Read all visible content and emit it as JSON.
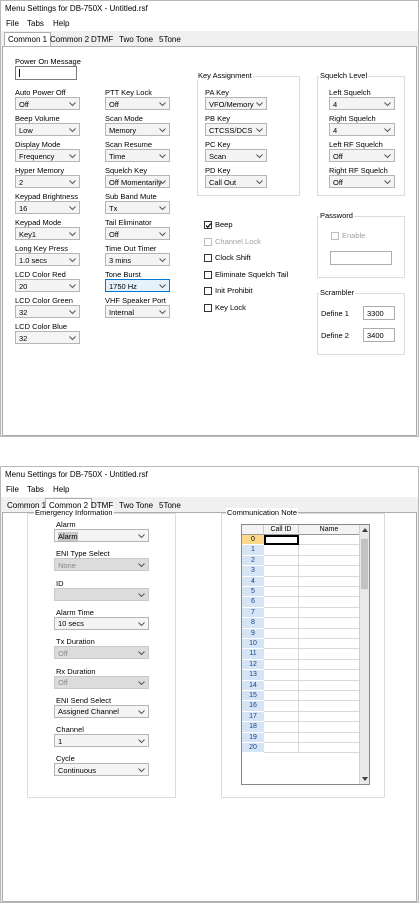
{
  "window_title": "Menu Settings for DB-750X - Untitled.rsf",
  "menu": [
    "File",
    "Tabs",
    "Help"
  ],
  "tabs": [
    "Common 1",
    "Common 2",
    "DTMF",
    "Two Tone",
    "5Tone"
  ],
  "common1": {
    "power_on_message": {
      "label": "Power On Message",
      "value": ""
    },
    "col1": [
      {
        "label": "Auto Power Off",
        "value": "Off"
      },
      {
        "label": "Beep Volume",
        "value": "Low"
      },
      {
        "label": "Display Mode",
        "value": "Frequency"
      },
      {
        "label": "Hyper Memory",
        "value": "2"
      },
      {
        "label": "Keypad Brightness",
        "value": "16"
      },
      {
        "label": "Keypad Mode",
        "value": "Key1"
      },
      {
        "label": "Long Key Press",
        "value": "1.0 secs"
      },
      {
        "label": "LCD Color Red",
        "value": "20"
      },
      {
        "label": "LCD Color Green",
        "value": "32"
      },
      {
        "label": "LCD Color Blue",
        "value": "32"
      }
    ],
    "col2": [
      {
        "label": "PTT Key Lock",
        "value": "Off"
      },
      {
        "label": "Scan Mode",
        "value": "Memory"
      },
      {
        "label": "Scan Resume",
        "value": "Time"
      },
      {
        "label": "Squelch Key",
        "value": "Off Momentarily"
      },
      {
        "label": "Sub Band Mute",
        "value": "Tx"
      },
      {
        "label": "Tail Eliminator",
        "value": "Off"
      },
      {
        "label": "Time Out Timer",
        "value": "3 mins"
      },
      {
        "label": "Tone Burst",
        "value": "1750 Hz"
      },
      {
        "label": "VHF Speaker Port",
        "value": "Internal"
      }
    ],
    "key_assignment": {
      "title": "Key Assignment",
      "items": [
        {
          "label": "PA Key",
          "value": "VFO/Memory"
        },
        {
          "label": "PB Key",
          "value": "CTCSS/DCS"
        },
        {
          "label": "PC Key",
          "value": "Scan"
        },
        {
          "label": "PD Key",
          "value": "Call Out"
        }
      ]
    },
    "checkboxes": [
      {
        "label": "Beep",
        "checked": true,
        "enabled": true
      },
      {
        "label": "Channel Lock",
        "checked": false,
        "enabled": false
      },
      {
        "label": "Clock Shift",
        "checked": false,
        "enabled": true
      },
      {
        "label": "Eliminate Squelch Tail",
        "checked": false,
        "enabled": true
      },
      {
        "label": "Init Prohibit",
        "checked": false,
        "enabled": true
      },
      {
        "label": "Key Lock",
        "checked": false,
        "enabled": true
      }
    ],
    "squelch_level": {
      "title": "Squelch Level",
      "items": [
        {
          "label": "Left Squelch",
          "value": "4"
        },
        {
          "label": "Right Squelch",
          "value": "4"
        },
        {
          "label": "Left RF Squelch",
          "value": "Off"
        },
        {
          "label": "Right RF Squelch",
          "value": "Off"
        }
      ]
    },
    "password": {
      "title": "Password",
      "enable_label": "Enable",
      "value": ""
    },
    "scrambler": {
      "title": "Scrambler",
      "items": [
        {
          "label": "Define 1",
          "value": "3300"
        },
        {
          "label": "Define 2",
          "value": "3400"
        }
      ]
    }
  },
  "common2": {
    "emergency": {
      "title": "Emergency Information",
      "fields": [
        {
          "label": "Alarm",
          "value": "Alarm",
          "enabled": true
        },
        {
          "label": "ENI Type Select",
          "value": "None",
          "enabled": false
        },
        {
          "label": "ID",
          "value": "",
          "enabled": false
        },
        {
          "label": "Alarm Time",
          "value": "10 secs",
          "enabled": true
        },
        {
          "label": "Tx Duration",
          "value": "Off",
          "enabled": false
        },
        {
          "label": "Rx Duration",
          "value": "Off",
          "enabled": false
        },
        {
          "label": "ENI Send Select",
          "value": "Assigned Channel",
          "enabled": true
        },
        {
          "label": "Channel",
          "value": "1",
          "enabled": true
        },
        {
          "label": "Cycle",
          "value": "Continuous",
          "enabled": true
        }
      ]
    },
    "communication_note": {
      "title": "Communication Note",
      "columns": [
        "Call ID",
        "Name"
      ],
      "rows": [
        "0",
        "1",
        "2",
        "3",
        "4",
        "5",
        "6",
        "7",
        "8",
        "9",
        "10",
        "11",
        "12",
        "13",
        "14",
        "15",
        "16",
        "17",
        "18",
        "19",
        "20"
      ]
    }
  },
  "colors": {
    "accent": "#0078d7",
    "row_header": "#d6e5f5",
    "current_row": "#fcd98a"
  }
}
